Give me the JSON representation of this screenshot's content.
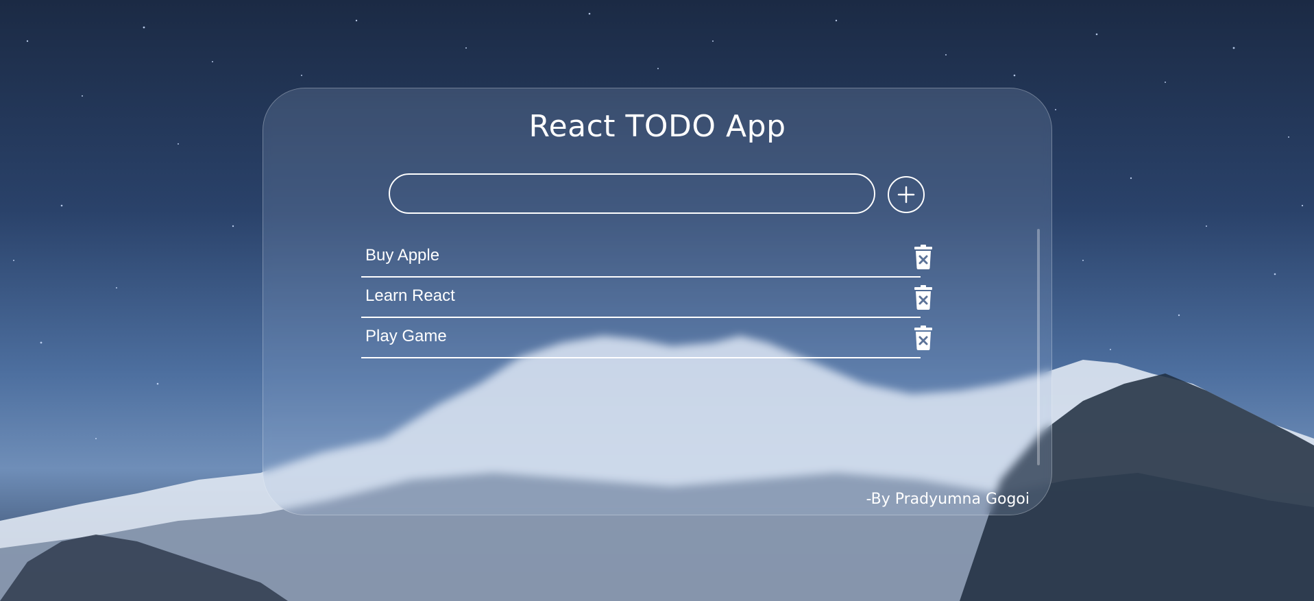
{
  "app": {
    "title": "React TODO App",
    "author": "-By Pradyumna Gogoi"
  },
  "input": {
    "value": "",
    "placeholder": ""
  },
  "add_button": {
    "label": "+",
    "icon": "plus-circle-icon"
  },
  "todos": [
    {
      "text": "Buy Apple",
      "delete_icon": "trash-x-icon"
    },
    {
      "text": "Learn React",
      "delete_icon": "trash-x-icon"
    },
    {
      "text": "Play Game",
      "delete_icon": "trash-x-icon"
    }
  ],
  "colors": {
    "text": "#ffffff",
    "card_border": "#ffffff"
  }
}
